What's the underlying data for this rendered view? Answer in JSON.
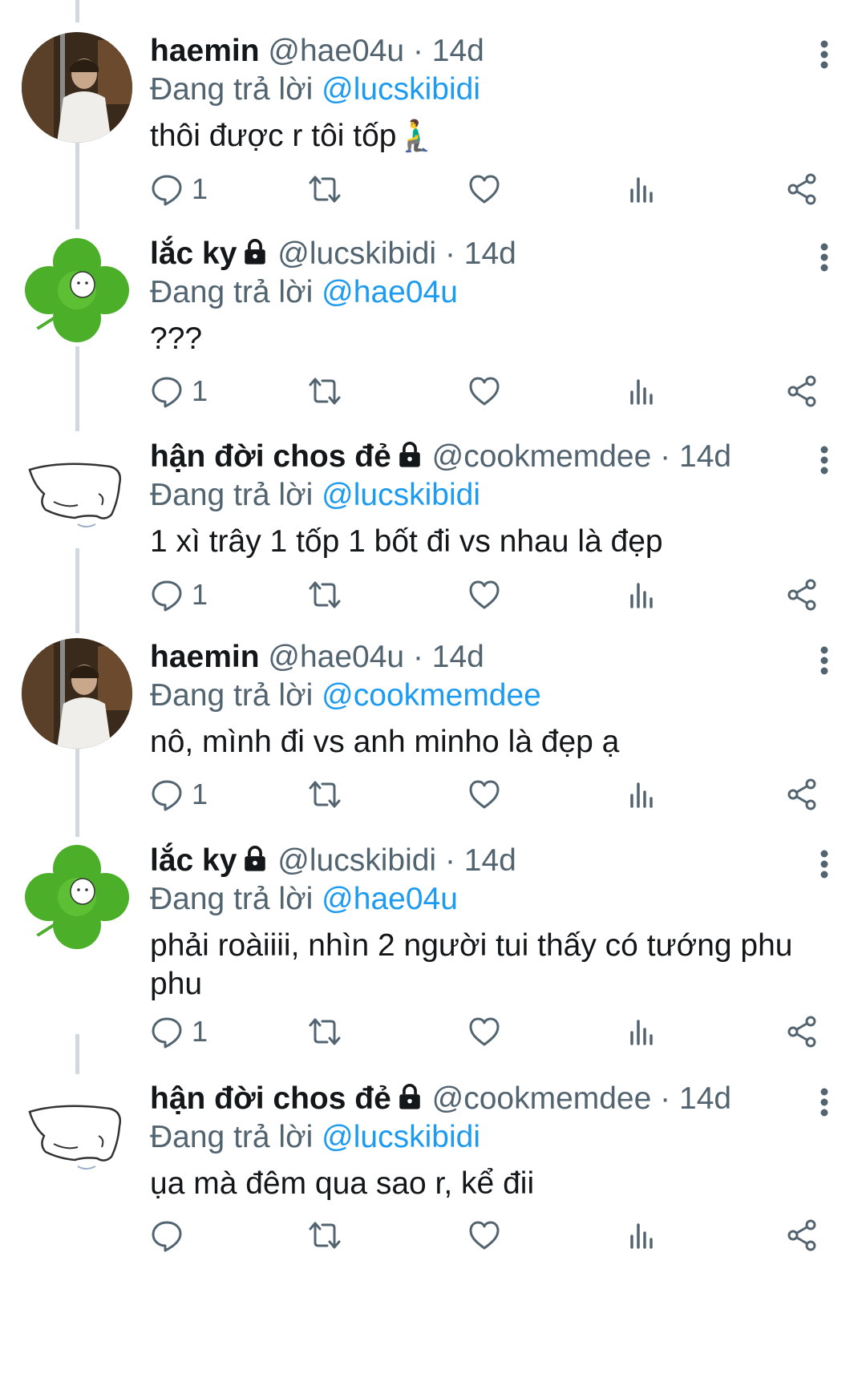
{
  "reply_prefix": "Đang trả lời",
  "accent_color": "#1d9bf0",
  "tweets": [
    {
      "name": "haemin",
      "locked": false,
      "handle": "@hae04u",
      "sep": " · ",
      "time": "14d",
      "reply_to": "@lucskibidi",
      "text": "thôi được r tôi tốp🧎‍♂️",
      "replies": "1",
      "avatar": "photo-person"
    },
    {
      "name": "lắc ky",
      "locked": true,
      "handle": "@lucskibidi",
      "sep": " · ",
      "time": "14d",
      "reply_to": "@hae04u",
      "text": "???",
      "replies": "1",
      "avatar": "clover"
    },
    {
      "name": "hận đời chos đẻ",
      "locked": true,
      "handle": "@cookmemdee",
      "sep": " · ",
      "time": "14d",
      "reply_to": "@lucskibidi",
      "text": "1 xì trây 1 tốp 1 bốt đi vs nhau là đẹp",
      "replies": "1",
      "avatar": "sketch"
    },
    {
      "name": "haemin",
      "locked": false,
      "handle": "@hae04u",
      "sep": " · ",
      "time": "14d",
      "reply_to": "@cookmemdee",
      "text": "nô, mình đi vs anh minho là đẹp ạ",
      "replies": "1",
      "avatar": "photo-person"
    },
    {
      "name": "lắc ky",
      "locked": true,
      "handle": "@lucskibidi",
      "sep": " · ",
      "time": "14d",
      "reply_to": "@hae04u",
      "text": "phải roàiiii, nhìn 2 người tui thấy có tướng phu phu",
      "replies": "1",
      "avatar": "clover"
    },
    {
      "name": "hận đời chos đẻ",
      "locked": true,
      "handle": "@cookmemdee",
      "sep": " · ",
      "time": "14d",
      "reply_to": "@lucskibidi",
      "text": "ụa mà đêm qua sao r, kể đii",
      "replies": "",
      "avatar": "sketch"
    }
  ]
}
